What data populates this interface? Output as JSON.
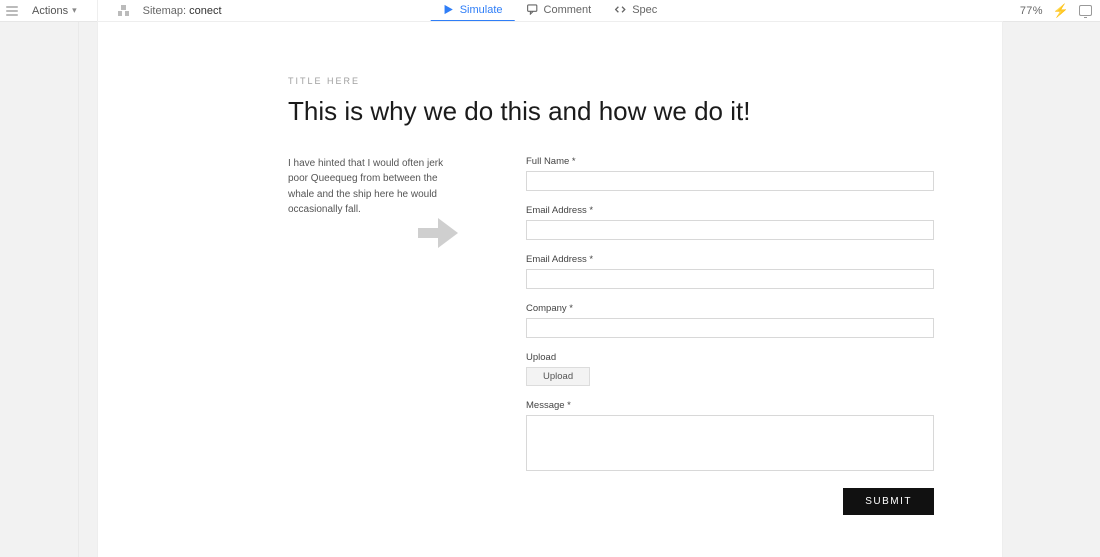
{
  "toolbar": {
    "actions_label": "Actions",
    "sitemap_prefix": "Sitemap:",
    "sitemap_name": "conect",
    "tabs": {
      "simulate": "Simulate",
      "comment": "Comment",
      "spec": "Spec"
    },
    "zoom": "77%"
  },
  "page": {
    "eyebrow": "TITLE HERE",
    "headline": "This is why we do this and how we do it!",
    "intro": "I have hinted that I would often jerk poor Queequeg from between the whale and the ship here he would occasionally fall.",
    "fields": {
      "full_name": "Full Name *",
      "email1": "Email Address *",
      "email2": "Email Address *",
      "company": "Company *",
      "upload_label": "Upload",
      "upload_button": "Upload",
      "message": "Message *",
      "submit": "SUBMIT"
    }
  }
}
